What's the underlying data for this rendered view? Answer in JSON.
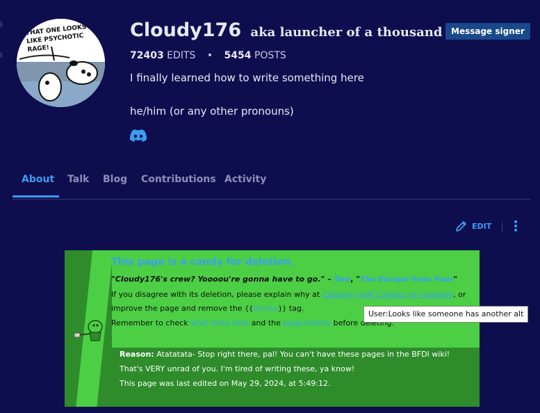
{
  "profile": {
    "avatar_text": "THAT ONE LOOKS LIKE PSYCHOTIC RAGE!",
    "username": "Cloudy176",
    "aka": "aka launcher of a thousand edits",
    "badge": "Message signer",
    "edits_count": "72403",
    "edits_label": "EDITS",
    "posts_count": "5454",
    "posts_label": "POSTS",
    "separator": "•",
    "bio": "I finally learned how to write something here",
    "pronouns": "he/him (or any other pronouns)",
    "social_icon": "discord-icon"
  },
  "tabs": [
    {
      "label": "About",
      "active": true
    },
    {
      "label": "Talk"
    },
    {
      "label": "Blog"
    },
    {
      "label": "Contributions"
    },
    {
      "label": "Activity"
    }
  ],
  "toolbar": {
    "edit_label": "EDIT",
    "more_icon": "more-vertical-icon"
  },
  "notice": {
    "title": "This page is a candy for deletion.",
    "quote": "\"Cloudy176's crew? Yoooou're gonna have to go.\"",
    "quote_dash": " – ",
    "quote_author": "Two",
    "quote_sep": ", \"",
    "quote_source": "The Escape from Four",
    "quote_end": "\"",
    "line1_prefix": "If you disagree with its deletion, please explain why at ",
    "line1_link": "Category talk:Candies for deletion",
    "line1_suffix": ", or",
    "line2_prefix": "improve the page and remove the ",
    "line2_tmpl_open": "{{",
    "line2_tmpl_name": "Delete",
    "line2_tmpl_close": "}}",
    "line2_suffix": " tag.",
    "line3_prefix": "Remember to check ",
    "line3_link1": "what links here",
    "line3_mid": " and the ",
    "line3_link2": "page history",
    "line3_suffix": " before deleting.",
    "reason_label": "Reason:",
    "reason_text": " Atatatata- Stop right there, pal! You can't have these pages in the BFDI wiki!",
    "reason_line2": "That's VERY unrad of you. I'm tired of writing these, ya know!",
    "last_edited": "This page was last edited on May 29, 2024, at 5:49:12."
  },
  "tooltip": "User:Looks like someone has another alt",
  "colors": {
    "background": "#0e0e4f",
    "accent": "#3c9cf0",
    "notice_green": "#4ccf44",
    "notice_dark_green": "#2e8c2a",
    "badge_blue": "#19498a"
  }
}
